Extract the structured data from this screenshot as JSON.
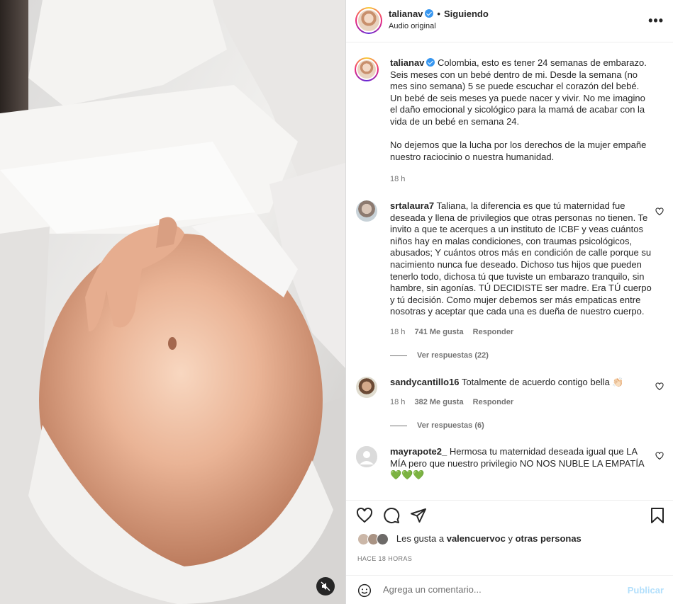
{
  "header": {
    "username": "talianav",
    "separator": "•",
    "follow_status": "Siguiendo",
    "audio": "Audio original",
    "more": "•••"
  },
  "caption": {
    "username": "talianav",
    "text": "Colombia, esto es tener 24 semanas de embarazo. Seis meses con un bebé dentro de mi. Desde la semana (no mes sino semana) 5 se puede escuchar el corazón del bebé. Un bebé de seis meses ya puede nacer y vivir. No me imagino el daño emocional y sicológico para la mamá de acabar con la vida de un bebé en semana 24.",
    "text2": "No dejemos que la lucha por los derechos de la mujer empañe nuestro raciocinio o nuestra humanidad.",
    "time": "18 h"
  },
  "comments": [
    {
      "username": "srtalaura7",
      "text": "Taliana, la diferencia es que tú maternidad fue deseada y llena de privilegios que otras personas no tienen. Te invito a que te acerques a un instituto de ICBF y veas cuántos niños hay en malas condiciones, con traumas psicológicos, abusados; Y cuántos otros más en condición de calle porque su nacimiento nunca fue deseado. Dichoso tus hijos que pueden tenerlo todo, dichosa tú que tuviste un embarazo tranquilo, sin hambre, sin agonías. TÚ DECIDISTE ser madre. Era TÚ cuerpo y tú decisión. Como mujer debemos ser más empaticas entre nosotras y aceptar que cada una es dueña de nuestro cuerpo.",
      "time": "18 h",
      "likes": "741 Me gusta",
      "reply": "Responder",
      "view_replies": "Ver respuestas (22)"
    },
    {
      "username": "sandycantillo16",
      "text": "Totalmente de acuerdo contigo bella 👏🏻",
      "time": "18 h",
      "likes": "382 Me gusta",
      "reply": "Responder",
      "view_replies": "Ver respuestas (6)"
    },
    {
      "username": "mayrapote2_",
      "text": "Hermosa tu maternidad deseada igual que LA MÍA pero que nuestro privilegio NO NOS NUBLE LA EMPATÍA",
      "emoji": "💚💚💚"
    }
  ],
  "likes_line": {
    "prefix": "Les gusta a",
    "user": "valencuervoc",
    "conj": "y",
    "others": "otras personas"
  },
  "post_time": "HACE 18 HORAS",
  "comment_box": {
    "placeholder": "Agrega un comentario...",
    "post_label": "Publicar"
  },
  "icons": [
    "heart-icon",
    "comment-icon",
    "share-icon",
    "bookmark-icon",
    "emoji-icon",
    "mute-icon",
    "verified-icon",
    "more-icon"
  ],
  "colors": {
    "verified": "#3897f0",
    "post_button": "#b2dffc",
    "emoji_hearts": "#22c55e"
  }
}
